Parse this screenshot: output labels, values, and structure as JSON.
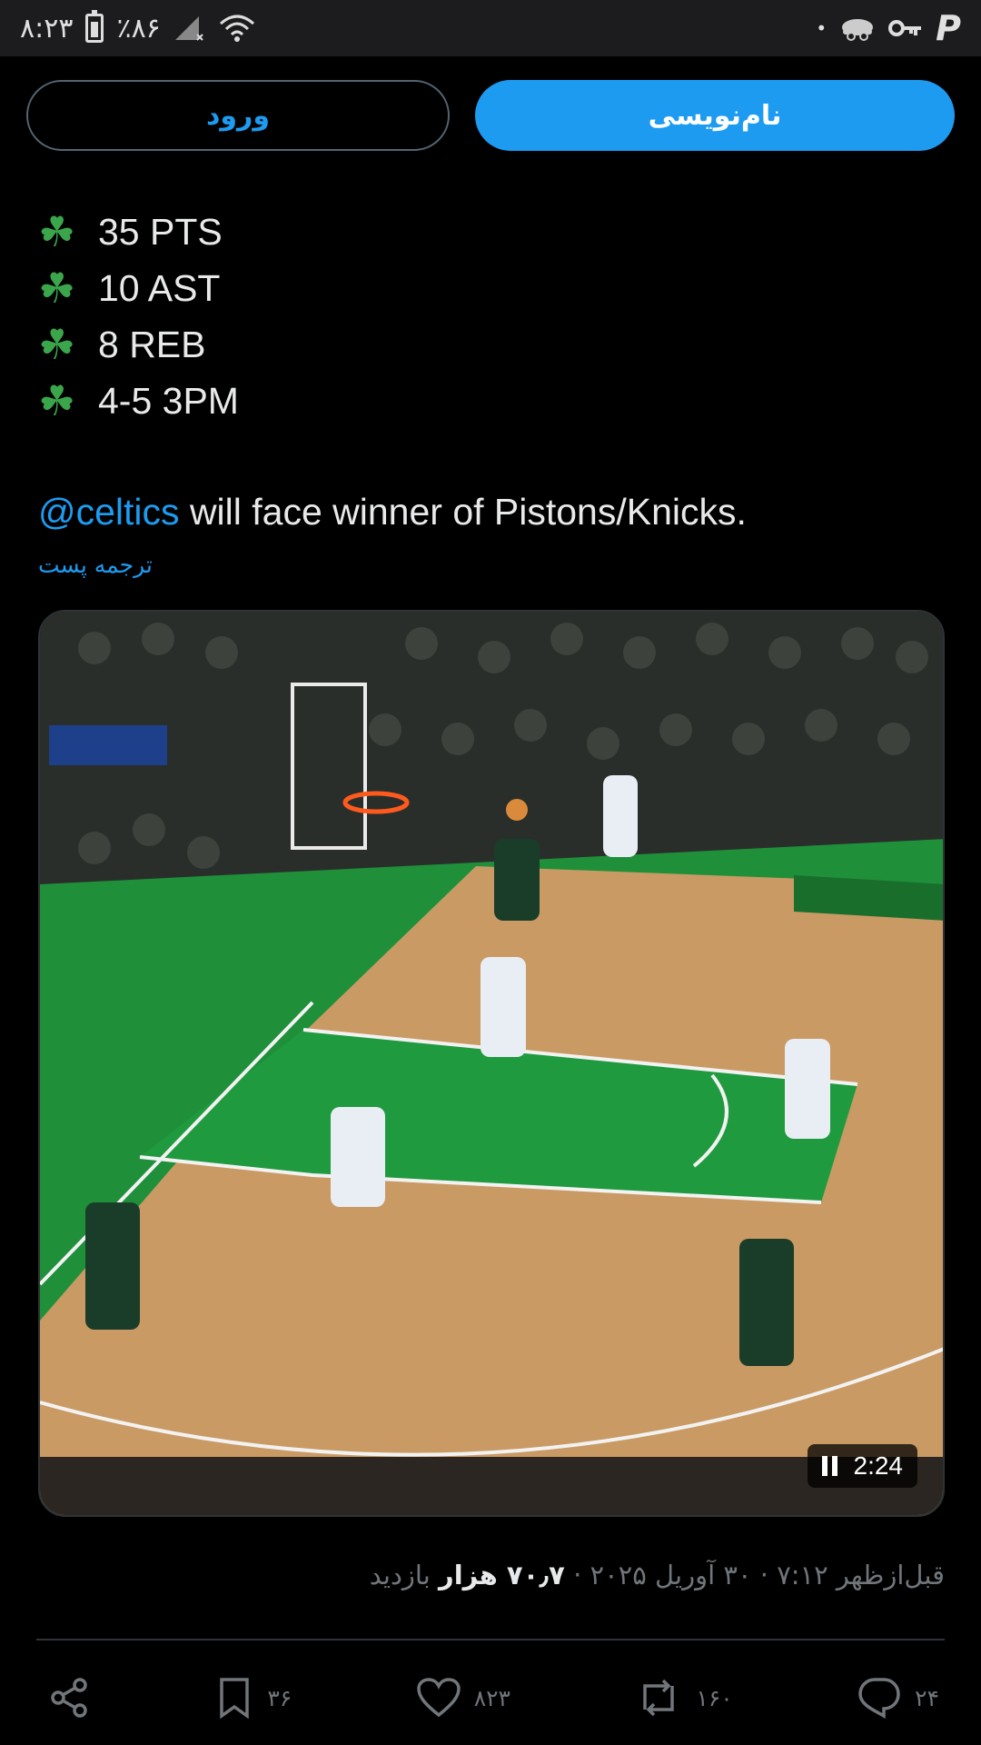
{
  "status_bar": {
    "time": "۸:۲۳",
    "battery": "٪۸۶",
    "dot": "•",
    "app_letter": "P"
  },
  "auth": {
    "signup_label": "نام‌نویسی",
    "login_label": "ورود"
  },
  "tweet": {
    "stats": [
      "35 PTS",
      "10 AST",
      "8 REB",
      "4-5 3PM"
    ],
    "mention": "@celtics",
    "sentence_rest": " will face winner of Pistons/Knicks.",
    "translate_label": "ترجمه پست"
  },
  "video": {
    "duration": "2:24",
    "state": "playing"
  },
  "meta": {
    "time_date": "قبل‌ازظهر ۷:۱۲ · ۳۰ آوریل ۲۰۲۵ · ",
    "views_count": "۷۰٫۷ هزار",
    "views_label": " بازدید"
  },
  "actions": {
    "replies": "۲۴",
    "reposts": "۱۶۰",
    "likes": "۸۲۳",
    "bookmarks": "۳۶"
  },
  "colors": {
    "accent": "#1d9bf0",
    "background": "#000000",
    "muted": "#71767b",
    "clover": "#3aa54a"
  }
}
